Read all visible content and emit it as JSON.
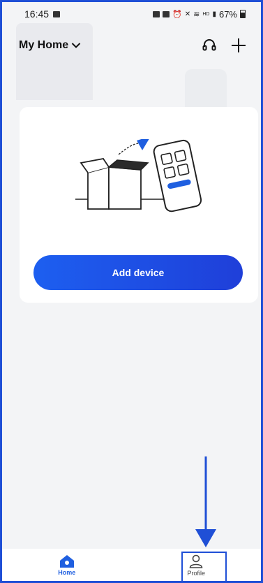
{
  "status_bar": {
    "time": "16:45",
    "indicators": "HD",
    "battery": "67%"
  },
  "header": {
    "home_name": "My Home",
    "support_icon": "headset-icon",
    "add_icon": "plus-icon"
  },
  "empty_state": {
    "add_device_label": "Add device"
  },
  "bottom_nav": {
    "items": [
      {
        "label": "Home",
        "icon": "home-icon",
        "active": true
      },
      {
        "label": "Profile",
        "icon": "user-icon",
        "active": false
      }
    ]
  },
  "colors": {
    "accent": "#1f5fe0",
    "annotation": "#1f4fd6",
    "background": "#f3f4f6"
  }
}
